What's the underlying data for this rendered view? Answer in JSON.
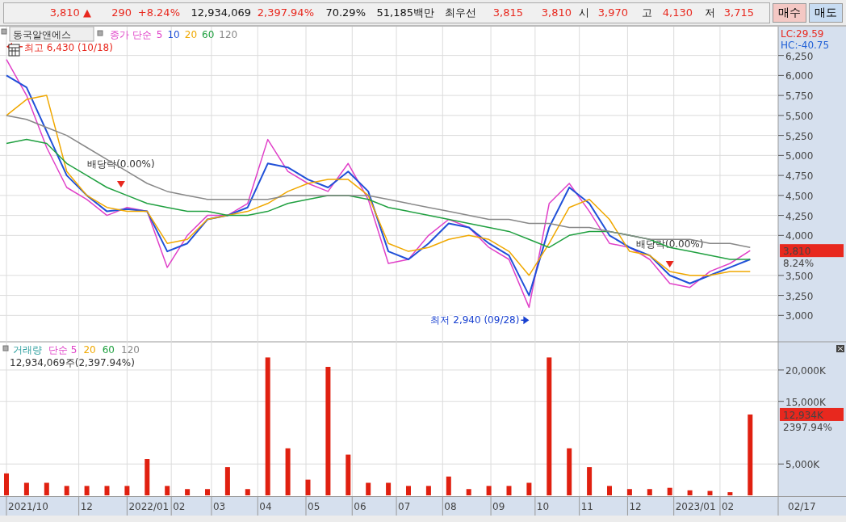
{
  "quote_bar": {
    "fields": [
      {
        "text": "3,810 ▲",
        "kind": "up"
      },
      {
        "text": "290",
        "kind": "up"
      },
      {
        "text": "+8.24%",
        "kind": "up"
      },
      {
        "text": "12,934,069",
        "kind": "plain"
      },
      {
        "text": "2,397.94%",
        "kind": "up"
      },
      {
        "text": "70.29%",
        "kind": "plain"
      },
      {
        "text": "51,185백만",
        "kind": "plain"
      },
      {
        "text": "최우선",
        "kind": "plain"
      },
      {
        "text": "3,815",
        "kind": "up"
      },
      {
        "text": "3,810",
        "kind": "up"
      },
      {
        "text": "시",
        "kind": "plain"
      },
      {
        "text": "3,970",
        "kind": "up"
      },
      {
        "text": "고",
        "kind": "plain"
      },
      {
        "text": "4,130",
        "kind": "up"
      },
      {
        "text": "저",
        "kind": "plain"
      },
      {
        "text": "3,715",
        "kind": "up"
      }
    ],
    "buttons": [
      {
        "label": "매수",
        "kind": "buy"
      },
      {
        "label": "매도",
        "kind": "sell"
      }
    ]
  },
  "price_pane": {
    "stock_name": "동국알앤에스",
    "legend_prefix": "종가 단순",
    "lc": "LC:29.59",
    "hc": "HC:-40.75",
    "last_price": "3,810",
    "last_change": "8.24%",
    "markers": [
      {
        "kind": "high",
        "text": "최고 6,430 (10/18)"
      },
      {
        "kind": "dividend",
        "text": "배당락(0.00%)"
      },
      {
        "kind": "low",
        "text": "최저 2,940 (09/28)"
      },
      {
        "kind": "dividend",
        "text": "배당락(0.00%)"
      }
    ],
    "chart_data": {
      "type": "line",
      "ylim": [
        2680,
        6610
      ],
      "grid": true,
      "yticks": [
        {
          "value": 3000,
          "label": "3,000"
        },
        {
          "value": 3250,
          "label": "3,250"
        },
        {
          "value": 3500,
          "label": "3,500"
        },
        {
          "value": 4000,
          "label": "4,000"
        },
        {
          "value": 4250,
          "label": "4,250"
        },
        {
          "value": 4500,
          "label": "4,500"
        },
        {
          "value": 4750,
          "label": "4,750"
        },
        {
          "value": 5000,
          "label": "5,000"
        },
        {
          "value": 5250,
          "label": "5,250"
        },
        {
          "value": 5500,
          "label": "5,500"
        },
        {
          "value": 5750,
          "label": "5,750"
        },
        {
          "value": 6000,
          "label": "6,000"
        },
        {
          "value": 6250,
          "label": "6,250"
        }
      ],
      "series": [
        {
          "name": "5",
          "color": "#e040c8",
          "values": [
            6200,
            5750,
            5100,
            4600,
            4450,
            4250,
            4350,
            4300,
            3600,
            4000,
            4250,
            4250,
            4400,
            5200,
            4800,
            4650,
            4550,
            4900,
            4450,
            3650,
            3700,
            4000,
            4200,
            4100,
            3850,
            3700,
            3100,
            4400,
            4650,
            4300,
            3900,
            3850,
            3700,
            3400,
            3350,
            3550,
            3650,
            3810
          ]
        },
        {
          "name": "10",
          "color": "#2050d8",
          "values": [
            6000,
            5850,
            5300,
            4750,
            4500,
            4300,
            4330,
            4300,
            3800,
            3900,
            4200,
            4250,
            4350,
            4900,
            4850,
            4700,
            4600,
            4800,
            4550,
            3800,
            3700,
            3900,
            4150,
            4100,
            3900,
            3750,
            3250,
            4100,
            4600,
            4400,
            4000,
            3850,
            3750,
            3500,
            3400,
            3500,
            3600,
            3700
          ]
        },
        {
          "name": "20",
          "color": "#f0a800",
          "values": [
            5500,
            5700,
            5750,
            4800,
            4500,
            4350,
            4300,
            4300,
            3900,
            3950,
            4200,
            4250,
            4300,
            4400,
            4550,
            4650,
            4700,
            4700,
            4500,
            3900,
            3800,
            3850,
            3950,
            4000,
            3950,
            3800,
            3500,
            3900,
            4350,
            4450,
            4200,
            3800,
            3750,
            3550,
            3500,
            3500,
            3550,
            3550
          ]
        },
        {
          "name": "60",
          "color": "#20a040",
          "values": [
            5150,
            5200,
            5150,
            4900,
            4750,
            4600,
            4500,
            4400,
            4350,
            4300,
            4300,
            4250,
            4250,
            4300,
            4400,
            4450,
            4500,
            4500,
            4450,
            4350,
            4300,
            4250,
            4200,
            4150,
            4100,
            4050,
            3950,
            3850,
            4000,
            4050,
            4050,
            4000,
            3950,
            3850,
            3800,
            3750,
            3700,
            3700
          ]
        },
        {
          "name": "120",
          "color": "#888888",
          "values": [
            5500,
            5450,
            5350,
            5250,
            5100,
            4950,
            4800,
            4650,
            4550,
            4500,
            4450,
            4450,
            4450,
            4450,
            4500,
            4500,
            4500,
            4500,
            4500,
            4450,
            4400,
            4350,
            4300,
            4250,
            4200,
            4200,
            4150,
            4150,
            4100,
            4100,
            4050,
            4000,
            3950,
            3950,
            3950,
            3900,
            3900,
            3850
          ]
        }
      ]
    }
  },
  "volume_pane": {
    "legend": [
      {
        "label": "단순 5",
        "color": "#e040c8"
      },
      {
        "label": "20",
        "color": "#f0a800"
      },
      {
        "label": "60",
        "color": "#20a040"
      },
      {
        "label": "120",
        "color": "#888888"
      }
    ],
    "summary": "12,934,069주(2,397.94%)",
    "last_volume": "12,934K",
    "last_ratio": "2397.94%",
    "chart_data": {
      "type": "bar",
      "ylim": [
        0,
        24500
      ],
      "grid": true,
      "yticks": [
        {
          "value": 5000,
          "label": "5,000K"
        },
        {
          "value": 15000,
          "label": "15,000K"
        },
        {
          "value": 20000,
          "label": "20,000K"
        }
      ],
      "series": [
        {
          "name": "거래량",
          "color": "#e02010",
          "values": [
            3500,
            2000,
            2000,
            1500,
            1500,
            1500,
            1500,
            5800,
            1500,
            1000,
            1000,
            4500,
            1000,
            22000,
            7500,
            2500,
            20500,
            6500,
            2000,
            2000,
            1500,
            1500,
            3000,
            1000,
            1500,
            1500,
            2000,
            22000,
            7500,
            4500,
            1500,
            1000,
            1000,
            1200,
            800,
            700,
            500,
            12900
          ]
        }
      ]
    }
  },
  "x_axis": {
    "labels": [
      "2021/10",
      "12",
      "2022/01",
      "02",
      "03",
      "04",
      "05",
      "06",
      "07",
      "08",
      "09",
      "10",
      "11",
      "12",
      "2023/01",
      "02"
    ],
    "current_date": "02/17"
  }
}
